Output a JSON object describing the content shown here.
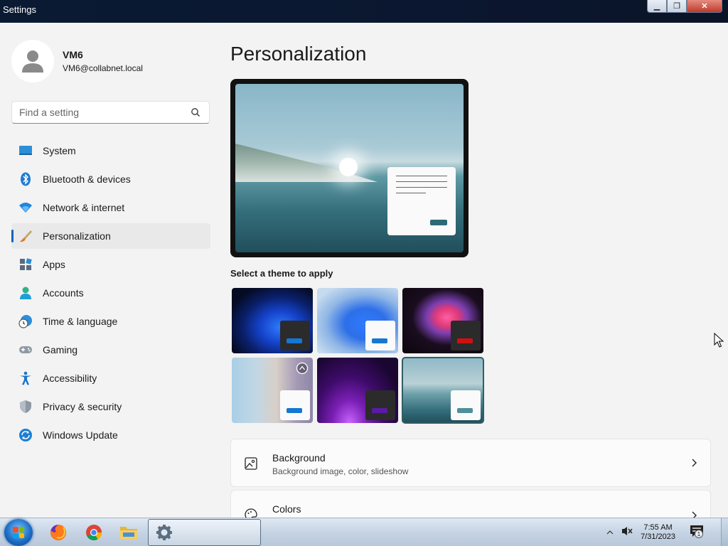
{
  "window": {
    "title": "Settings",
    "min_label": "▁",
    "max_label": "❐",
    "close_label": "✕"
  },
  "profile": {
    "name": "VM6",
    "email": "VM6@collabnet.local"
  },
  "search": {
    "placeholder": "Find a setting"
  },
  "nav": {
    "items": [
      {
        "label": "System",
        "icon": "monitor-icon"
      },
      {
        "label": "Bluetooth & devices",
        "icon": "bluetooth-icon"
      },
      {
        "label": "Network & internet",
        "icon": "wifi-icon"
      },
      {
        "label": "Personalization",
        "icon": "paintbrush-icon",
        "active": true
      },
      {
        "label": "Apps",
        "icon": "apps-icon"
      },
      {
        "label": "Accounts",
        "icon": "person-icon"
      },
      {
        "label": "Time & language",
        "icon": "clock-globe-icon"
      },
      {
        "label": "Gaming",
        "icon": "gamepad-icon"
      },
      {
        "label": "Accessibility",
        "icon": "accessibility-icon"
      },
      {
        "label": "Privacy & security",
        "icon": "shield-icon"
      },
      {
        "label": "Windows Update",
        "icon": "update-icon"
      }
    ]
  },
  "main": {
    "title": "Personalization",
    "theme_heading": "Select a theme to apply",
    "themes": [
      {
        "name": "windows-dark",
        "selected": false
      },
      {
        "name": "windows-light",
        "selected": false
      },
      {
        "name": "glow",
        "selected": false
      },
      {
        "name": "captured-motion",
        "selected": false
      },
      {
        "name": "sunrise",
        "selected": false
      },
      {
        "name": "flow",
        "selected": true
      }
    ],
    "cards": [
      {
        "title": "Background",
        "subtitle": "Background image, color, slideshow",
        "icon": "image-icon"
      },
      {
        "title": "Colors",
        "subtitle": "",
        "icon": "palette-icon"
      }
    ]
  },
  "taskbar": {
    "apps": [
      "firefox-icon",
      "chrome-icon",
      "file-explorer-icon"
    ],
    "active_app": "settings-icon",
    "time": "7:55 AM",
    "date": "7/31/2023",
    "notification_count": "1"
  },
  "colors": {
    "accent": "#0067c0",
    "selected_theme_outline": "#2f5f66"
  }
}
